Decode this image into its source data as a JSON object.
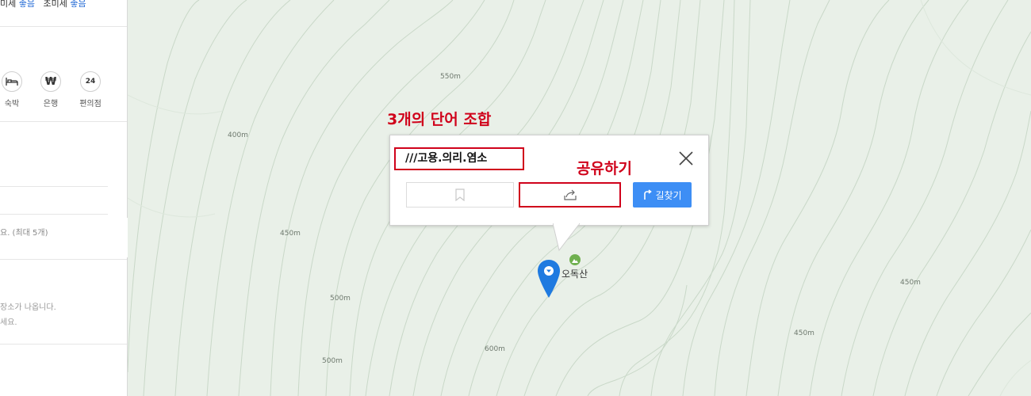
{
  "sidebar": {
    "air_quality": {
      "fine_dust_label": "미세",
      "fine_dust_status": "좋음",
      "ultrafine_label": "초미세",
      "ultrafine_status": "좋음"
    },
    "categories": [
      {
        "label": "숙박",
        "icon": "bed-icon"
      },
      {
        "label": "은행",
        "icon": "won-icon",
        "glyph": "₩"
      },
      {
        "label": "편의점",
        "icon": "convenience-24-icon",
        "glyph": "24"
      }
    ],
    "hint_max": "요. (최대 5개)",
    "hint_line1": "장소가 나옵니다.",
    "hint_line2": "세요."
  },
  "map": {
    "contour_labels": [
      {
        "text": "550m"
      },
      {
        "text": "400m"
      },
      {
        "text": "450m"
      },
      {
        "text": "500m"
      },
      {
        "text": "600m"
      },
      {
        "text": "500m"
      },
      {
        "text": "450m"
      },
      {
        "text": "450m"
      }
    ],
    "poi": {
      "name": "오독산",
      "icon": "mountain-icon"
    },
    "pin_icon": "location-pin-icon"
  },
  "popup": {
    "address": "///고용.의리.염소",
    "save_icon": "bookmark-icon",
    "share_icon": "share-icon",
    "route_label": "길찾기",
    "route_icon": "route-icon",
    "close_icon": "close-icon"
  },
  "annotations": {
    "three_words": "3개의 단어 조합",
    "share": "공유하기"
  },
  "colors": {
    "accent_blue": "#3d8ef5",
    "annotation_red": "#d0021b",
    "map_green": "#e9f0e8"
  }
}
